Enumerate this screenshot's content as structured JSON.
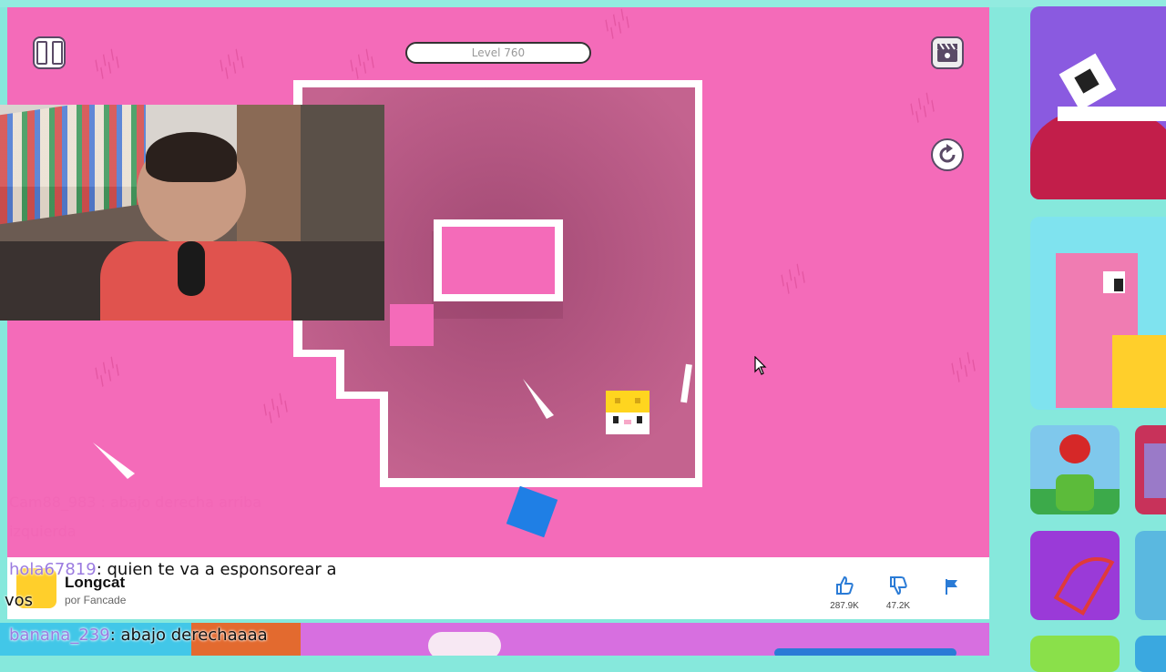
{
  "game": {
    "level_label": "Level 760",
    "title": "Longcat",
    "author": "por Fancade",
    "likes": "287.9K",
    "dislikes": "47.2K"
  },
  "icons": {
    "pause": "pause-icon",
    "camera": "clapperboard-icon",
    "restart": "restart-icon",
    "like": "thumbs-up-icon",
    "dislike": "thumbs-down-icon",
    "report": "flag-icon"
  },
  "chat": [
    {
      "user": "hola67819",
      "message": ": quien te va a esponsorear a",
      "cont": "vos"
    },
    {
      "user": "banana_239",
      "message": ": abajo derechaaaa"
    }
  ],
  "ghost_chat": {
    "line1": "Cam88_983 : abajo derecha arriba",
    "line2": "izquierda"
  },
  "colors": {
    "pink": "#f46bb9",
    "pit": "#b85a86",
    "player_blue": "#1f7fe5",
    "cat_yellow": "#ffd51f",
    "accent_blue": "#2a7bd6"
  }
}
